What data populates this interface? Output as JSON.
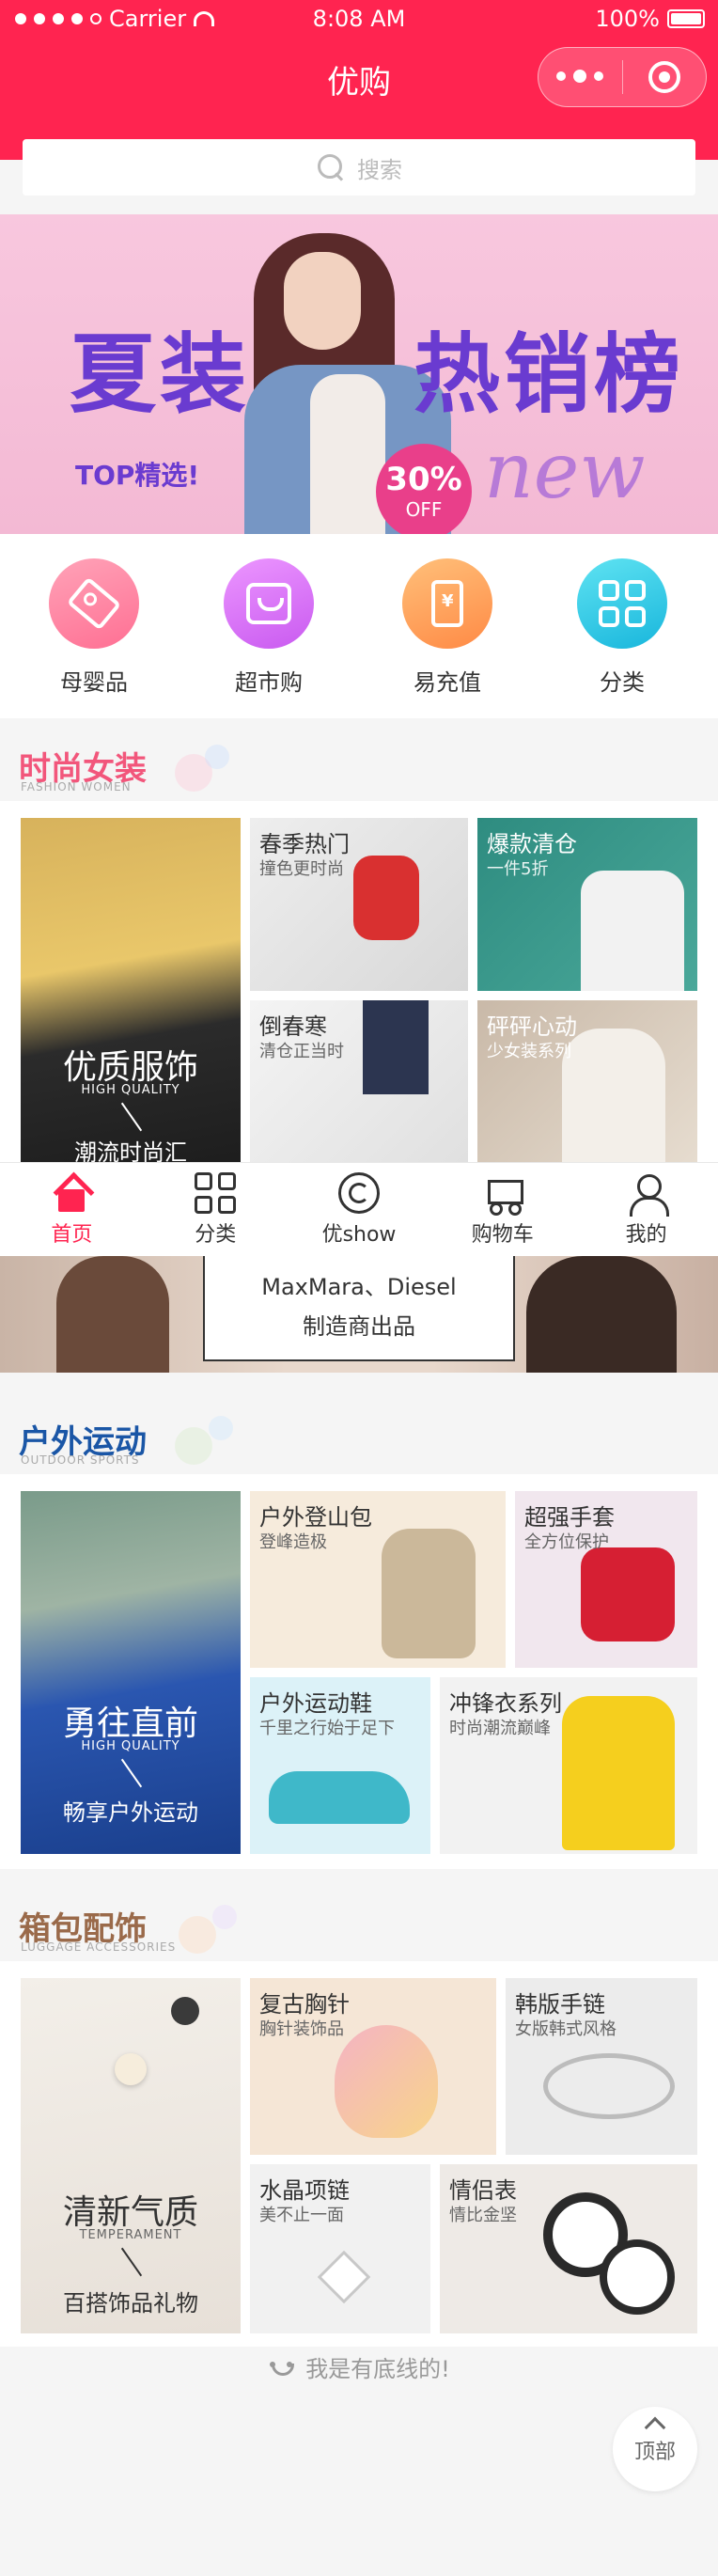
{
  "status_bar": {
    "carrier": "Carrier",
    "time": "8:08 AM",
    "battery": "100%"
  },
  "nav": {
    "title": "优购"
  },
  "search": {
    "placeholder": "搜索"
  },
  "banner": {
    "text_left": "夏装",
    "text_right": "热销榜",
    "tagline": "TOP精选!",
    "discount": "30%",
    "off": "OFF",
    "new": "new"
  },
  "categories": [
    {
      "label": "母婴品",
      "icon": "tag-icon",
      "color": "#ff7b9c"
    },
    {
      "label": "超市购",
      "icon": "shop-icon",
      "color": "#d86bf0"
    },
    {
      "label": "易充值",
      "icon": "phone-recharge-icon",
      "color": "#ff9e55"
    },
    {
      "label": "分类",
      "icon": "grid-icon",
      "color": "#29c8e0"
    }
  ],
  "fashion": {
    "title": "时尚女装",
    "subtitle": "FASHION WOMEN",
    "title_color": "#f2567b",
    "big": {
      "title": "优质服饰",
      "sub": "HIGH QUALITY",
      "bottom": "潮流时尚汇"
    },
    "cards": [
      {
        "title": "春季热门",
        "sub": "撞色更时尚"
      },
      {
        "title": "爆款清仓",
        "sub": "一件5折"
      },
      {
        "title": "倒春寒",
        "sub": "清仓正当时"
      },
      {
        "title": "砰砰心动",
        "sub": "少女装系列"
      }
    ]
  },
  "tabbar": {
    "items": [
      {
        "label": "首页",
        "icon": "home-icon"
      },
      {
        "label": "分类",
        "icon": "category-grid-icon"
      },
      {
        "label": "优show",
        "icon": "show-icon"
      },
      {
        "label": "购物车",
        "icon": "cart-icon"
      },
      {
        "label": "我的",
        "icon": "user-icon"
      }
    ],
    "active_color": "#ff2450"
  },
  "brand_banner": {
    "line1": "MaxMara、Diesel",
    "line2": "制造商出品"
  },
  "outdoor": {
    "title": "户外运动",
    "subtitle": "OUTDOOR SPORTS",
    "title_color": "#1a56a6",
    "big": {
      "title": "勇往直前",
      "sub": "HIGH QUALITY",
      "bottom": "畅享户外运动"
    },
    "cards": [
      {
        "title": "户外登山包",
        "sub": "登峰造极"
      },
      {
        "title": "超强手套",
        "sub": "全方位保护"
      },
      {
        "title": "户外运动鞋",
        "sub": "千里之行始于足下"
      },
      {
        "title": "冲锋衣系列",
        "sub": "时尚潮流巅峰"
      }
    ]
  },
  "bags": {
    "title": "箱包配饰",
    "subtitle": "LUGGAGE ACCESSORIES",
    "title_color": "#9a6a4a",
    "big": {
      "title": "清新气质",
      "sub": "TEMPERAMENT",
      "bottom": "百搭饰品礼物"
    },
    "cards": [
      {
        "title": "复古胸针",
        "sub": "胸针装饰品"
      },
      {
        "title": "韩版手链",
        "sub": "女版韩式风格"
      },
      {
        "title": "水晶项链",
        "sub": "美不止一面"
      },
      {
        "title": "情侣表",
        "sub": "情比金坚"
      }
    ]
  },
  "footer": {
    "end_text": "我是有底线的!",
    "top_button": "顶部"
  },
  "colors": {
    "primary": "#ff2450",
    "search_placeholder": "#bbbbbb",
    "footer_text": "#999999"
  }
}
